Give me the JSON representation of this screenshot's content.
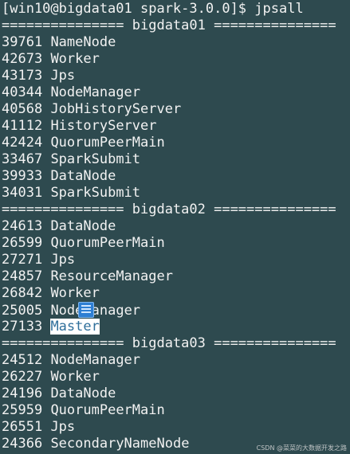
{
  "prompt": "[win10@bigdata01 spark-3.0.0]$ jpsall",
  "sections": [
    {
      "header": "=============== bigdata01 ===============",
      "processes": [
        {
          "pid": "39761",
          "name": "NameNode"
        },
        {
          "pid": "42673",
          "name": "Worker"
        },
        {
          "pid": "43173",
          "name": "Jps"
        },
        {
          "pid": "40344",
          "name": "NodeManager"
        },
        {
          "pid": "40568",
          "name": "JobHistoryServer"
        },
        {
          "pid": "41112",
          "name": "HistoryServer"
        },
        {
          "pid": "42424",
          "name": "QuorumPeerMain"
        },
        {
          "pid": "33467",
          "name": "SparkSubmit"
        },
        {
          "pid": "39933",
          "name": "DataNode"
        },
        {
          "pid": "34031",
          "name": "SparkSubmit"
        }
      ]
    },
    {
      "header": "=============== bigdata02 ===============",
      "processes": [
        {
          "pid": "24613",
          "name": "DataNode"
        },
        {
          "pid": "26599",
          "name": "QuorumPeerMain"
        },
        {
          "pid": "27271",
          "name": "Jps"
        },
        {
          "pid": "24857",
          "name": "ResourceManager"
        },
        {
          "pid": "26842",
          "name": "Worker"
        },
        {
          "pid": "25005",
          "name": "NodeManager"
        },
        {
          "pid": "27133",
          "name": "Master",
          "selected": true
        }
      ]
    },
    {
      "header": "=============== bigdata03 ===============",
      "processes": [
        {
          "pid": "24512",
          "name": "NodeManager"
        },
        {
          "pid": "26227",
          "name": "Worker"
        },
        {
          "pid": "24196",
          "name": "DataNode"
        },
        {
          "pid": "25959",
          "name": "QuorumPeerMain"
        },
        {
          "pid": "26551",
          "name": "Jps"
        },
        {
          "pid": "24366",
          "name": "SecondaryNameNode"
        }
      ]
    }
  ],
  "watermark": "CSDN @菜菜的大数据开发之路",
  "colors": {
    "background": "#2e4a4f",
    "text": "#f2f2f2",
    "selection_bg": "#ffffff",
    "selection_text": "#2f6f9b",
    "overlay_icon": "#2e7fd3"
  },
  "overlay_icon": "clipboard-chip-icon"
}
